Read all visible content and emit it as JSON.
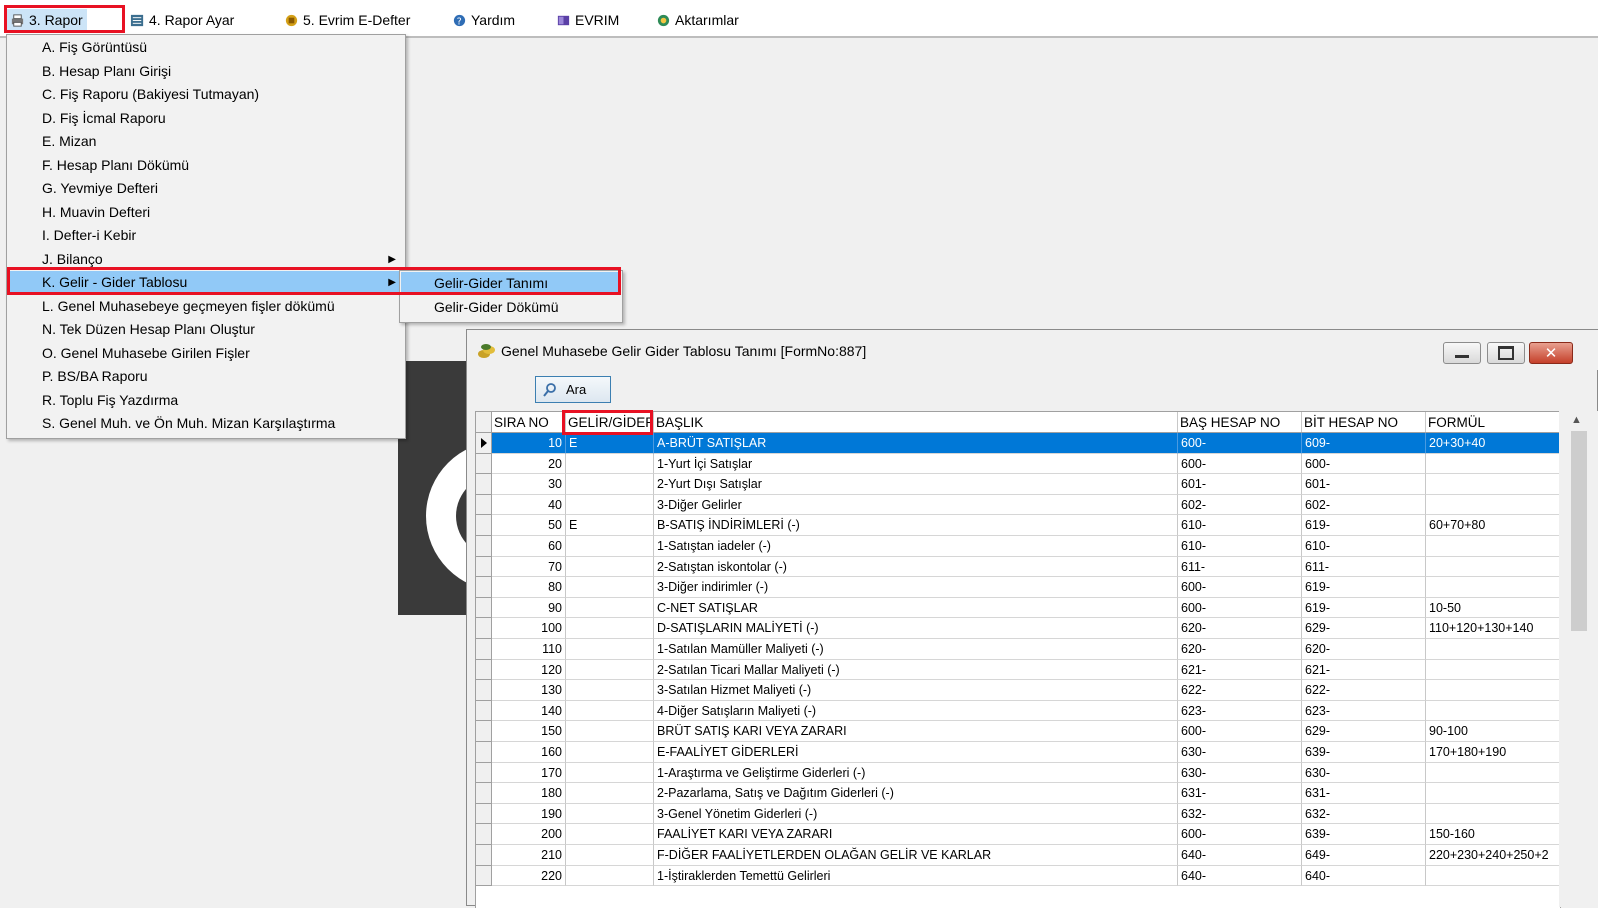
{
  "menubar": {
    "items": [
      {
        "label": "3.  Rapor",
        "icon": "printer-icon"
      },
      {
        "label": "4.   Rapor Ayar",
        "icon": "report-settings-icon"
      },
      {
        "label": "5. Evrim E-Defter",
        "icon": "e-ledger-icon"
      },
      {
        "label": "Yardım",
        "icon": "help-icon"
      },
      {
        "label": "EVRIM",
        "icon": "book-icon"
      },
      {
        "label": "Aktarımlar",
        "icon": "transfer-icon"
      }
    ]
  },
  "dropdown": {
    "items": [
      "A.   Fiş Görüntüsü",
      "B.   Hesap Planı Girişi",
      "C.  Fiş Raporu (Bakiyesi Tutmayan)",
      "D.   Fiş İcmal Raporu",
      "E.   Mizan",
      "F.   Hesap Planı Dökümü",
      "G.   Yevmiye Defteri",
      "H.   Muavin Defteri",
      "I.   Defter-i Kebir",
      "J.   Bilanço",
      "K.   Gelir - Gider Tablosu",
      "L.   Genel Muhasebeye geçmeyen fişler dökümü",
      "N.  Tek Düzen Hesap Planı Oluştur",
      "O. Genel Muhasebe Girilen Fişler",
      "P. BS/BA Raporu",
      "R. Toplu Fiş Yazdırma",
      "S. Genel Muh. ve Ön Muh. Mizan Karşılaştırma"
    ]
  },
  "submenu": {
    "items": [
      "Gelir-Gider Tanımı",
      "Gelir-Gider Dökümü"
    ]
  },
  "window": {
    "title": "Genel Muhasebe Gelir Gider Tablosu Tanımı [FormNo:887]",
    "search_button": "Ara",
    "columns": [
      "SIRA NO",
      "GELİR/GİDER",
      "BAŞLIK",
      "BAŞ HESAP NO",
      "BİT HESAP NO",
      "FORMÜL"
    ],
    "rows": [
      {
        "sira": "10",
        "gg": "E",
        "baslik": "A-BRÜT SATIŞLAR",
        "bas": "600-",
        "bit": "609-",
        "formul": "20+30+40"
      },
      {
        "sira": "20",
        "gg": "",
        "baslik": " 1-Yurt İçi Satışlar",
        "bas": "600-",
        "bit": "600-",
        "formul": ""
      },
      {
        "sira": "30",
        "gg": "",
        "baslik": " 2-Yurt Dışı Satışlar",
        "bas": "601-",
        "bit": "601-",
        "formul": ""
      },
      {
        "sira": "40",
        "gg": "",
        "baslik": " 3-Diğer Gelirler",
        "bas": "602-",
        "bit": "602-",
        "formul": ""
      },
      {
        "sira": "50",
        "gg": "E",
        "baslik": " B-SATIŞ İNDİRİMLERİ (-)",
        "bas": "610-",
        "bit": "619-",
        "formul": "60+70+80"
      },
      {
        "sira": "60",
        "gg": "",
        "baslik": " 1-Satıştan iadeler (-)",
        "bas": "610-",
        "bit": "610-",
        "formul": ""
      },
      {
        "sira": "70",
        "gg": "",
        "baslik": " 2-Satıştan iskontolar (-)",
        "bas": "611-",
        "bit": "611-",
        "formul": ""
      },
      {
        "sira": "80",
        "gg": "",
        "baslik": " 3-Diğer indirimler (-)",
        "bas": "600-",
        "bit": "619-",
        "formul": ""
      },
      {
        "sira": "90",
        "gg": "",
        "baslik": "C-NET SATIŞLAR",
        "bas": "600-",
        "bit": "619-",
        "formul": "10-50"
      },
      {
        "sira": "100",
        "gg": "",
        "baslik": "D-SATIŞLARIN MALİYETİ (-)",
        "bas": "620-",
        "bit": "629-",
        "formul": "110+120+130+140"
      },
      {
        "sira": "110",
        "gg": "",
        "baslik": " 1-Satılan Mamüller Maliyeti (-)",
        "bas": "620-",
        "bit": "620-",
        "formul": ""
      },
      {
        "sira": "120",
        "gg": "",
        "baslik": " 2-Satılan Ticari Mallar Maliyeti (-)",
        "bas": "621-",
        "bit": "621-",
        "formul": ""
      },
      {
        "sira": "130",
        "gg": "",
        "baslik": " 3-Satılan Hizmet Maliyeti (-)",
        "bas": "622-",
        "bit": "622-",
        "formul": ""
      },
      {
        "sira": "140",
        "gg": "",
        "baslik": " 4-Diğer Satışların Maliyeti (-)",
        "bas": "623-",
        "bit": "623-",
        "formul": ""
      },
      {
        "sira": "150",
        "gg": "",
        "baslik": "BRÜT SATIŞ KARI VEYA ZARARI",
        "bas": "600-",
        "bit": "629-",
        "formul": "90-100"
      },
      {
        "sira": "160",
        "gg": "",
        "baslik": "E-FAALİYET GİDERLERİ",
        "bas": "630-",
        "bit": "639-",
        "formul": "170+180+190"
      },
      {
        "sira": "170",
        "gg": "",
        "baslik": "    1-Araştırma ve Geliştirme Giderleri (-)",
        "bas": "630-",
        "bit": "630-",
        "formul": ""
      },
      {
        "sira": "180",
        "gg": "",
        "baslik": " 2-Pazarlama, Satış ve Dağıtım Giderleri (-)",
        "bas": "631-",
        "bit": "631-",
        "formul": ""
      },
      {
        "sira": "190",
        "gg": "",
        "baslik": " 3-Genel Yönetim Giderleri (-)",
        "bas": "632-",
        "bit": "632-",
        "formul": ""
      },
      {
        "sira": "200",
        "gg": "",
        "baslik": "FAALİYET KARI VEYA ZARARI",
        "bas": "600-",
        "bit": "639-",
        "formul": "150-160"
      },
      {
        "sira": "210",
        "gg": "",
        "baslik": "F-DİĞER FAALİYETLERDEN OLAĞAN GELİR VE KARLAR",
        "bas": "640-",
        "bit": "649-",
        "formul": "220+230+240+250+2"
      },
      {
        "sira": "220",
        "gg": "",
        "baslik": " 1-İştiraklerden Temettü Gelirleri",
        "bas": "640-",
        "bit": "640-",
        "formul": ""
      }
    ]
  },
  "colors": {
    "selection": "#0078d7",
    "menu_highlight": "#91c9f7",
    "annotation_box": "#e81123"
  }
}
